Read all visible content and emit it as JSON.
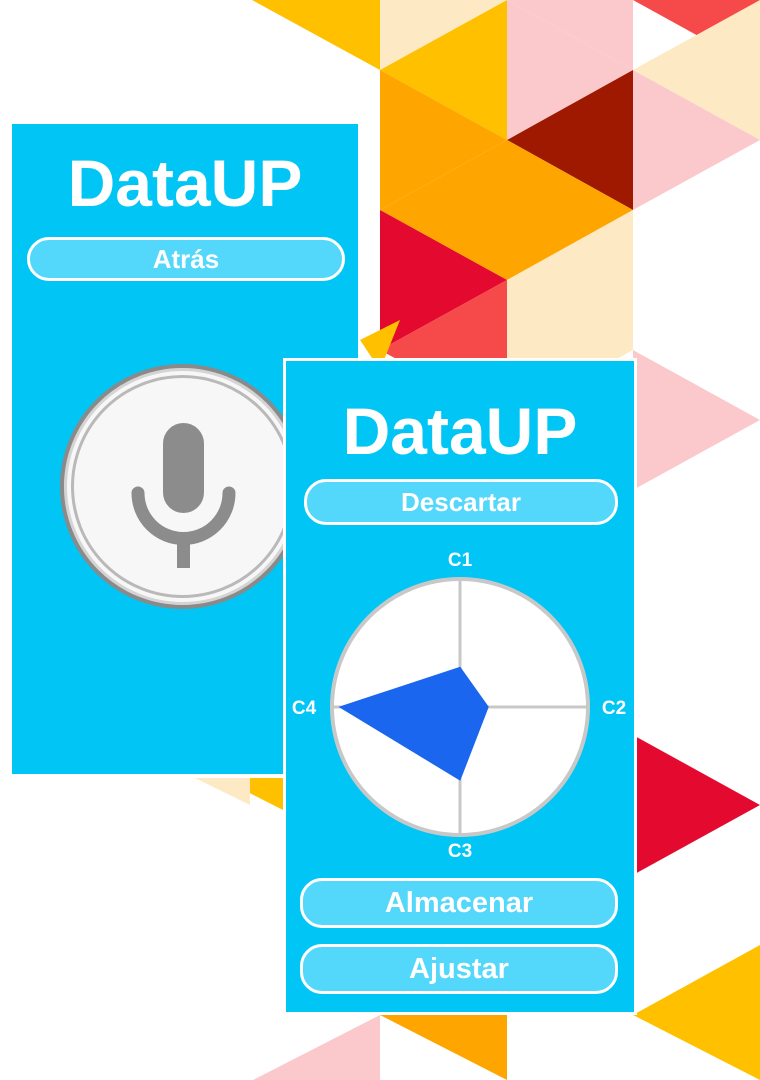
{
  "screens": [
    {
      "app_title": "DataUP",
      "back_button_label": "Atrás",
      "mic_icon": "microphone-icon"
    },
    {
      "app_title": "DataUP",
      "discard_button_label": "Descartar",
      "store_button_label": "Almacenar",
      "adjust_button_label": "Ajustar"
    }
  ],
  "chart_data": {
    "type": "radar",
    "axes": [
      "C1",
      "C2",
      "C3",
      "C4"
    ],
    "values": [
      0.31,
      0.22,
      0.57,
      0.94
    ],
    "range": [
      0,
      1
    ],
    "fill_color": "#1a66ee"
  },
  "colors": {
    "screen_background": "#00c5f5",
    "button_fill": "#53d7fb",
    "text": "#ffffff",
    "decor": [
      "#ffc000",
      "#ffa500",
      "#f64a4a",
      "#e3092f",
      "#9e1900",
      "#fbc9cc",
      "#fde9c3"
    ]
  }
}
